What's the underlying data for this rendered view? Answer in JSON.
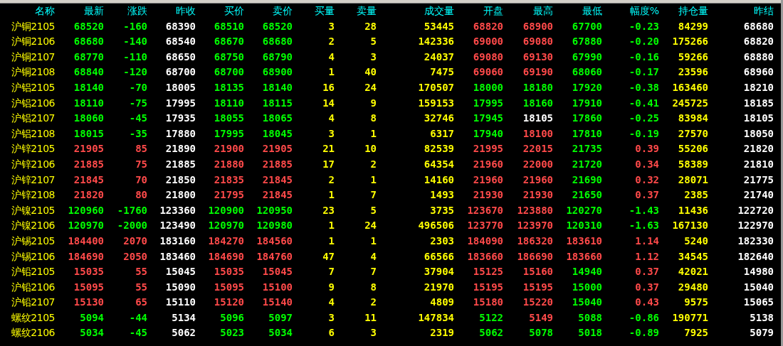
{
  "columns": [
    {
      "label": "名称",
      "kind": "name"
    },
    {
      "label": "最新",
      "kind": "colored"
    },
    {
      "label": "涨跌",
      "kind": "colored"
    },
    {
      "label": "昨收",
      "kind": "plain"
    },
    {
      "label": "买价",
      "kind": "colored"
    },
    {
      "label": "卖价",
      "kind": "colored"
    },
    {
      "label": "买量",
      "kind": "volume"
    },
    {
      "label": "卖量",
      "kind": "volume"
    },
    {
      "label": "成交量",
      "kind": "volume"
    },
    {
      "label": "开盘",
      "kind": "colored"
    },
    {
      "label": "最高",
      "kind": "colored"
    },
    {
      "label": "最低",
      "kind": "colored"
    },
    {
      "label": "幅度%",
      "kind": "colored"
    },
    {
      "label": "持仓量",
      "kind": "volume"
    },
    {
      "label": "昨结",
      "kind": "plain"
    }
  ],
  "rows": [
    {
      "cells": [
        {
          "text": "沪铜2105"
        },
        {
          "text": "68520",
          "color": "#00ff00"
        },
        {
          "text": "-160",
          "color": "#00ff00"
        },
        {
          "text": "68390"
        },
        {
          "text": "68510",
          "color": "#00ff00"
        },
        {
          "text": "68520",
          "color": "#00ff00"
        },
        {
          "text": "3"
        },
        {
          "text": "28"
        },
        {
          "text": "53445"
        },
        {
          "text": "68820",
          "color": "#ff4a4a"
        },
        {
          "text": "68900",
          "color": "#ff4a4a"
        },
        {
          "text": "67700",
          "color": "#00ff00"
        },
        {
          "text": "-0.23",
          "color": "#00ff00"
        },
        {
          "text": "84299"
        },
        {
          "text": "68680"
        }
      ]
    },
    {
      "cells": [
        {
          "text": "沪铜2106"
        },
        {
          "text": "68680",
          "color": "#00ff00"
        },
        {
          "text": "-140",
          "color": "#00ff00"
        },
        {
          "text": "68540"
        },
        {
          "text": "68670",
          "color": "#00ff00"
        },
        {
          "text": "68680",
          "color": "#00ff00"
        },
        {
          "text": "2"
        },
        {
          "text": "5"
        },
        {
          "text": "142336"
        },
        {
          "text": "69000",
          "color": "#ff4a4a"
        },
        {
          "text": "69080",
          "color": "#ff4a4a"
        },
        {
          "text": "67880",
          "color": "#00ff00"
        },
        {
          "text": "-0.20",
          "color": "#00ff00"
        },
        {
          "text": "175266"
        },
        {
          "text": "68820"
        }
      ]
    },
    {
      "cells": [
        {
          "text": "沪铜2107"
        },
        {
          "text": "68770",
          "color": "#00ff00"
        },
        {
          "text": "-110",
          "color": "#00ff00"
        },
        {
          "text": "68650"
        },
        {
          "text": "68750",
          "color": "#00ff00"
        },
        {
          "text": "68790",
          "color": "#00ff00"
        },
        {
          "text": "4"
        },
        {
          "text": "3"
        },
        {
          "text": "24037"
        },
        {
          "text": "69080",
          "color": "#ff4a4a"
        },
        {
          "text": "69130",
          "color": "#ff4a4a"
        },
        {
          "text": "67990",
          "color": "#00ff00"
        },
        {
          "text": "-0.16",
          "color": "#00ff00"
        },
        {
          "text": "59266"
        },
        {
          "text": "68880"
        }
      ]
    },
    {
      "cells": [
        {
          "text": "沪铜2108"
        },
        {
          "text": "68840",
          "color": "#00ff00"
        },
        {
          "text": "-120",
          "color": "#00ff00"
        },
        {
          "text": "68700"
        },
        {
          "text": "68700",
          "color": "#00ff00"
        },
        {
          "text": "68900",
          "color": "#00ff00"
        },
        {
          "text": "1"
        },
        {
          "text": "40"
        },
        {
          "text": "7475"
        },
        {
          "text": "69060",
          "color": "#ff4a4a"
        },
        {
          "text": "69190",
          "color": "#ff4a4a"
        },
        {
          "text": "68060",
          "color": "#00ff00"
        },
        {
          "text": "-0.17",
          "color": "#00ff00"
        },
        {
          "text": "23596"
        },
        {
          "text": "68960"
        }
      ]
    },
    {
      "cells": [
        {
          "text": "沪铝2105"
        },
        {
          "text": "18140",
          "color": "#00ff00"
        },
        {
          "text": "-70",
          "color": "#00ff00"
        },
        {
          "text": "18005"
        },
        {
          "text": "18135",
          "color": "#00ff00"
        },
        {
          "text": "18140",
          "color": "#00ff00"
        },
        {
          "text": "16"
        },
        {
          "text": "24"
        },
        {
          "text": "170507"
        },
        {
          "text": "18000",
          "color": "#00ff00"
        },
        {
          "text": "18180",
          "color": "#00ff00"
        },
        {
          "text": "17920",
          "color": "#00ff00"
        },
        {
          "text": "-0.38",
          "color": "#00ff00"
        },
        {
          "text": "163460"
        },
        {
          "text": "18210"
        }
      ]
    },
    {
      "cells": [
        {
          "text": "沪铝2106"
        },
        {
          "text": "18110",
          "color": "#00ff00"
        },
        {
          "text": "-75",
          "color": "#00ff00"
        },
        {
          "text": "17995"
        },
        {
          "text": "18110",
          "color": "#00ff00"
        },
        {
          "text": "18115",
          "color": "#00ff00"
        },
        {
          "text": "14"
        },
        {
          "text": "9"
        },
        {
          "text": "159153"
        },
        {
          "text": "17995",
          "color": "#00ff00"
        },
        {
          "text": "18160",
          "color": "#00ff00"
        },
        {
          "text": "17910",
          "color": "#00ff00"
        },
        {
          "text": "-0.41",
          "color": "#00ff00"
        },
        {
          "text": "245725"
        },
        {
          "text": "18185"
        }
      ]
    },
    {
      "cells": [
        {
          "text": "沪铝2107"
        },
        {
          "text": "18060",
          "color": "#00ff00"
        },
        {
          "text": "-45",
          "color": "#00ff00"
        },
        {
          "text": "17935"
        },
        {
          "text": "18055",
          "color": "#00ff00"
        },
        {
          "text": "18065",
          "color": "#00ff00"
        },
        {
          "text": "4"
        },
        {
          "text": "8"
        },
        {
          "text": "32746"
        },
        {
          "text": "17945",
          "color": "#00ff00"
        },
        {
          "text": "18105",
          "color": "#ffffff"
        },
        {
          "text": "17860",
          "color": "#00ff00"
        },
        {
          "text": "-0.25",
          "color": "#00ff00"
        },
        {
          "text": "83984"
        },
        {
          "text": "18105"
        }
      ]
    },
    {
      "cells": [
        {
          "text": "沪铝2108"
        },
        {
          "text": "18015",
          "color": "#00ff00"
        },
        {
          "text": "-35",
          "color": "#00ff00"
        },
        {
          "text": "17880"
        },
        {
          "text": "17995",
          "color": "#00ff00"
        },
        {
          "text": "18045",
          "color": "#00ff00"
        },
        {
          "text": "3"
        },
        {
          "text": "1"
        },
        {
          "text": "6317"
        },
        {
          "text": "17940",
          "color": "#00ff00"
        },
        {
          "text": "18100",
          "color": "#ff4a4a"
        },
        {
          "text": "17810",
          "color": "#00ff00"
        },
        {
          "text": "-0.19",
          "color": "#00ff00"
        },
        {
          "text": "27570"
        },
        {
          "text": "18050"
        }
      ]
    },
    {
      "cells": [
        {
          "text": "沪锌2105"
        },
        {
          "text": "21905",
          "color": "#ff4a4a"
        },
        {
          "text": "85",
          "color": "#ff4a4a"
        },
        {
          "text": "21890"
        },
        {
          "text": "21900",
          "color": "#ff4a4a"
        },
        {
          "text": "21905",
          "color": "#ff4a4a"
        },
        {
          "text": "21"
        },
        {
          "text": "10"
        },
        {
          "text": "82539"
        },
        {
          "text": "21995",
          "color": "#ff4a4a"
        },
        {
          "text": "22015",
          "color": "#ff4a4a"
        },
        {
          "text": "21735",
          "color": "#00ff00"
        },
        {
          "text": "0.39",
          "color": "#ff4a4a"
        },
        {
          "text": "55206"
        },
        {
          "text": "21820"
        }
      ]
    },
    {
      "cells": [
        {
          "text": "沪锌2106"
        },
        {
          "text": "21885",
          "color": "#ff4a4a"
        },
        {
          "text": "75",
          "color": "#ff4a4a"
        },
        {
          "text": "21885"
        },
        {
          "text": "21880",
          "color": "#ff4a4a"
        },
        {
          "text": "21885",
          "color": "#ff4a4a"
        },
        {
          "text": "17"
        },
        {
          "text": "2"
        },
        {
          "text": "64354"
        },
        {
          "text": "21960",
          "color": "#ff4a4a"
        },
        {
          "text": "22000",
          "color": "#ff4a4a"
        },
        {
          "text": "21720",
          "color": "#00ff00"
        },
        {
          "text": "0.34",
          "color": "#ff4a4a"
        },
        {
          "text": "58389"
        },
        {
          "text": "21810"
        }
      ]
    },
    {
      "cells": [
        {
          "text": "沪锌2107"
        },
        {
          "text": "21845",
          "color": "#ff4a4a"
        },
        {
          "text": "70",
          "color": "#ff4a4a"
        },
        {
          "text": "21850"
        },
        {
          "text": "21835",
          "color": "#ff4a4a"
        },
        {
          "text": "21845",
          "color": "#ff4a4a"
        },
        {
          "text": "2"
        },
        {
          "text": "1"
        },
        {
          "text": "14160"
        },
        {
          "text": "21960",
          "color": "#ff4a4a"
        },
        {
          "text": "21960",
          "color": "#ff4a4a"
        },
        {
          "text": "21690",
          "color": "#00ff00"
        },
        {
          "text": "0.32",
          "color": "#ff4a4a"
        },
        {
          "text": "28071"
        },
        {
          "text": "21775"
        }
      ]
    },
    {
      "cells": [
        {
          "text": "沪锌2108"
        },
        {
          "text": "21820",
          "color": "#ff4a4a"
        },
        {
          "text": "80",
          "color": "#ff4a4a"
        },
        {
          "text": "21800"
        },
        {
          "text": "21795",
          "color": "#ff4a4a"
        },
        {
          "text": "21845",
          "color": "#ff4a4a"
        },
        {
          "text": "1"
        },
        {
          "text": "7"
        },
        {
          "text": "1493"
        },
        {
          "text": "21930",
          "color": "#ff4a4a"
        },
        {
          "text": "21930",
          "color": "#ff4a4a"
        },
        {
          "text": "21650",
          "color": "#00ff00"
        },
        {
          "text": "0.37",
          "color": "#ff4a4a"
        },
        {
          "text": "2385"
        },
        {
          "text": "21740"
        }
      ]
    },
    {
      "cells": [
        {
          "text": "沪镍2105"
        },
        {
          "text": "120960",
          "color": "#00ff00"
        },
        {
          "text": "-1760",
          "color": "#00ff00"
        },
        {
          "text": "123360"
        },
        {
          "text": "120900",
          "color": "#00ff00"
        },
        {
          "text": "120950",
          "color": "#00ff00"
        },
        {
          "text": "23"
        },
        {
          "text": "5"
        },
        {
          "text": "3735"
        },
        {
          "text": "123670",
          "color": "#ff4a4a"
        },
        {
          "text": "123880",
          "color": "#ff4a4a"
        },
        {
          "text": "120270",
          "color": "#00ff00"
        },
        {
          "text": "-1.43",
          "color": "#00ff00"
        },
        {
          "text": "11436"
        },
        {
          "text": "122720"
        }
      ]
    },
    {
      "cells": [
        {
          "text": "沪镍2106"
        },
        {
          "text": "120970",
          "color": "#00ff00"
        },
        {
          "text": "-2000",
          "color": "#00ff00"
        },
        {
          "text": "123490"
        },
        {
          "text": "120970",
          "color": "#00ff00"
        },
        {
          "text": "120980",
          "color": "#00ff00"
        },
        {
          "text": "1"
        },
        {
          "text": "24"
        },
        {
          "text": "496506"
        },
        {
          "text": "123770",
          "color": "#ff4a4a"
        },
        {
          "text": "123970",
          "color": "#ff4a4a"
        },
        {
          "text": "120310",
          "color": "#00ff00"
        },
        {
          "text": "-1.63",
          "color": "#00ff00"
        },
        {
          "text": "167130"
        },
        {
          "text": "122970"
        }
      ]
    },
    {
      "cells": [
        {
          "text": "沪锡2105"
        },
        {
          "text": "184400",
          "color": "#ff4a4a"
        },
        {
          "text": "2070",
          "color": "#ff4a4a"
        },
        {
          "text": "183160"
        },
        {
          "text": "184270",
          "color": "#ff4a4a"
        },
        {
          "text": "184560",
          "color": "#ff4a4a"
        },
        {
          "text": "1"
        },
        {
          "text": "1"
        },
        {
          "text": "2303"
        },
        {
          "text": "184090",
          "color": "#ff4a4a"
        },
        {
          "text": "186320",
          "color": "#ff4a4a"
        },
        {
          "text": "183610",
          "color": "#ff4a4a"
        },
        {
          "text": "1.14",
          "color": "#ff4a4a"
        },
        {
          "text": "5240"
        },
        {
          "text": "182330"
        }
      ]
    },
    {
      "cells": [
        {
          "text": "沪锡2106"
        },
        {
          "text": "184690",
          "color": "#ff4a4a"
        },
        {
          "text": "2050",
          "color": "#ff4a4a"
        },
        {
          "text": "183460"
        },
        {
          "text": "184690",
          "color": "#ff4a4a"
        },
        {
          "text": "184760",
          "color": "#ff4a4a"
        },
        {
          "text": "47"
        },
        {
          "text": "4"
        },
        {
          "text": "66566"
        },
        {
          "text": "183660",
          "color": "#ff4a4a"
        },
        {
          "text": "186690",
          "color": "#ff4a4a"
        },
        {
          "text": "183660",
          "color": "#ff4a4a"
        },
        {
          "text": "1.12",
          "color": "#ff4a4a"
        },
        {
          "text": "34545"
        },
        {
          "text": "182640"
        }
      ]
    },
    {
      "cells": [
        {
          "text": "沪铅2105"
        },
        {
          "text": "15035",
          "color": "#ff4a4a"
        },
        {
          "text": "55",
          "color": "#ff4a4a"
        },
        {
          "text": "15045"
        },
        {
          "text": "15035",
          "color": "#ff4a4a"
        },
        {
          "text": "15045",
          "color": "#ff4a4a"
        },
        {
          "text": "7"
        },
        {
          "text": "7"
        },
        {
          "text": "37904"
        },
        {
          "text": "15125",
          "color": "#ff4a4a"
        },
        {
          "text": "15160",
          "color": "#ff4a4a"
        },
        {
          "text": "14940",
          "color": "#00ff00"
        },
        {
          "text": "0.37",
          "color": "#ff4a4a"
        },
        {
          "text": "42021"
        },
        {
          "text": "14980"
        }
      ]
    },
    {
      "cells": [
        {
          "text": "沪铅2106"
        },
        {
          "text": "15095",
          "color": "#ff4a4a"
        },
        {
          "text": "55",
          "color": "#ff4a4a"
        },
        {
          "text": "15090"
        },
        {
          "text": "15095",
          "color": "#ff4a4a"
        },
        {
          "text": "15100",
          "color": "#ff4a4a"
        },
        {
          "text": "9"
        },
        {
          "text": "8"
        },
        {
          "text": "21970"
        },
        {
          "text": "15195",
          "color": "#ff4a4a"
        },
        {
          "text": "15195",
          "color": "#ff4a4a"
        },
        {
          "text": "15000",
          "color": "#00ff00"
        },
        {
          "text": "0.37",
          "color": "#ff4a4a"
        },
        {
          "text": "29480"
        },
        {
          "text": "15040"
        }
      ]
    },
    {
      "cells": [
        {
          "text": "沪铅2107"
        },
        {
          "text": "15130",
          "color": "#ff4a4a"
        },
        {
          "text": "65",
          "color": "#ff4a4a"
        },
        {
          "text": "15110"
        },
        {
          "text": "15120",
          "color": "#ff4a4a"
        },
        {
          "text": "15140",
          "color": "#ff4a4a"
        },
        {
          "text": "4"
        },
        {
          "text": "2"
        },
        {
          "text": "4809"
        },
        {
          "text": "15180",
          "color": "#ff4a4a"
        },
        {
          "text": "15220",
          "color": "#ff4a4a"
        },
        {
          "text": "15040",
          "color": "#00ff00"
        },
        {
          "text": "0.43",
          "color": "#ff4a4a"
        },
        {
          "text": "9575"
        },
        {
          "text": "15065"
        }
      ]
    },
    {
      "cells": [
        {
          "text": "螺纹2105"
        },
        {
          "text": "5094",
          "color": "#00ff00"
        },
        {
          "text": "-44",
          "color": "#00ff00"
        },
        {
          "text": "5134"
        },
        {
          "text": "5096",
          "color": "#00ff00"
        },
        {
          "text": "5097",
          "color": "#00ff00"
        },
        {
          "text": "3"
        },
        {
          "text": "11"
        },
        {
          "text": "147834"
        },
        {
          "text": "5122",
          "color": "#00ff00"
        },
        {
          "text": "5149",
          "color": "#ff4a4a"
        },
        {
          "text": "5088",
          "color": "#00ff00"
        },
        {
          "text": "-0.86",
          "color": "#00ff00"
        },
        {
          "text": "190771"
        },
        {
          "text": "5138"
        }
      ]
    },
    {
      "cells": [
        {
          "text": "螺纹2106"
        },
        {
          "text": "5034",
          "color": "#00ff00"
        },
        {
          "text": "-45",
          "color": "#00ff00"
        },
        {
          "text": "5062"
        },
        {
          "text": "5023",
          "color": "#00ff00"
        },
        {
          "text": "5034",
          "color": "#00ff00"
        },
        {
          "text": "6"
        },
        {
          "text": "3"
        },
        {
          "text": "2319"
        },
        {
          "text": "5062",
          "color": "#00ff00"
        },
        {
          "text": "5078",
          "color": "#00ff00"
        },
        {
          "text": "5018",
          "color": "#00ff00"
        },
        {
          "text": "-0.89",
          "color": "#00ff00"
        },
        {
          "text": "7925"
        },
        {
          "text": "5079"
        }
      ]
    }
  ]
}
